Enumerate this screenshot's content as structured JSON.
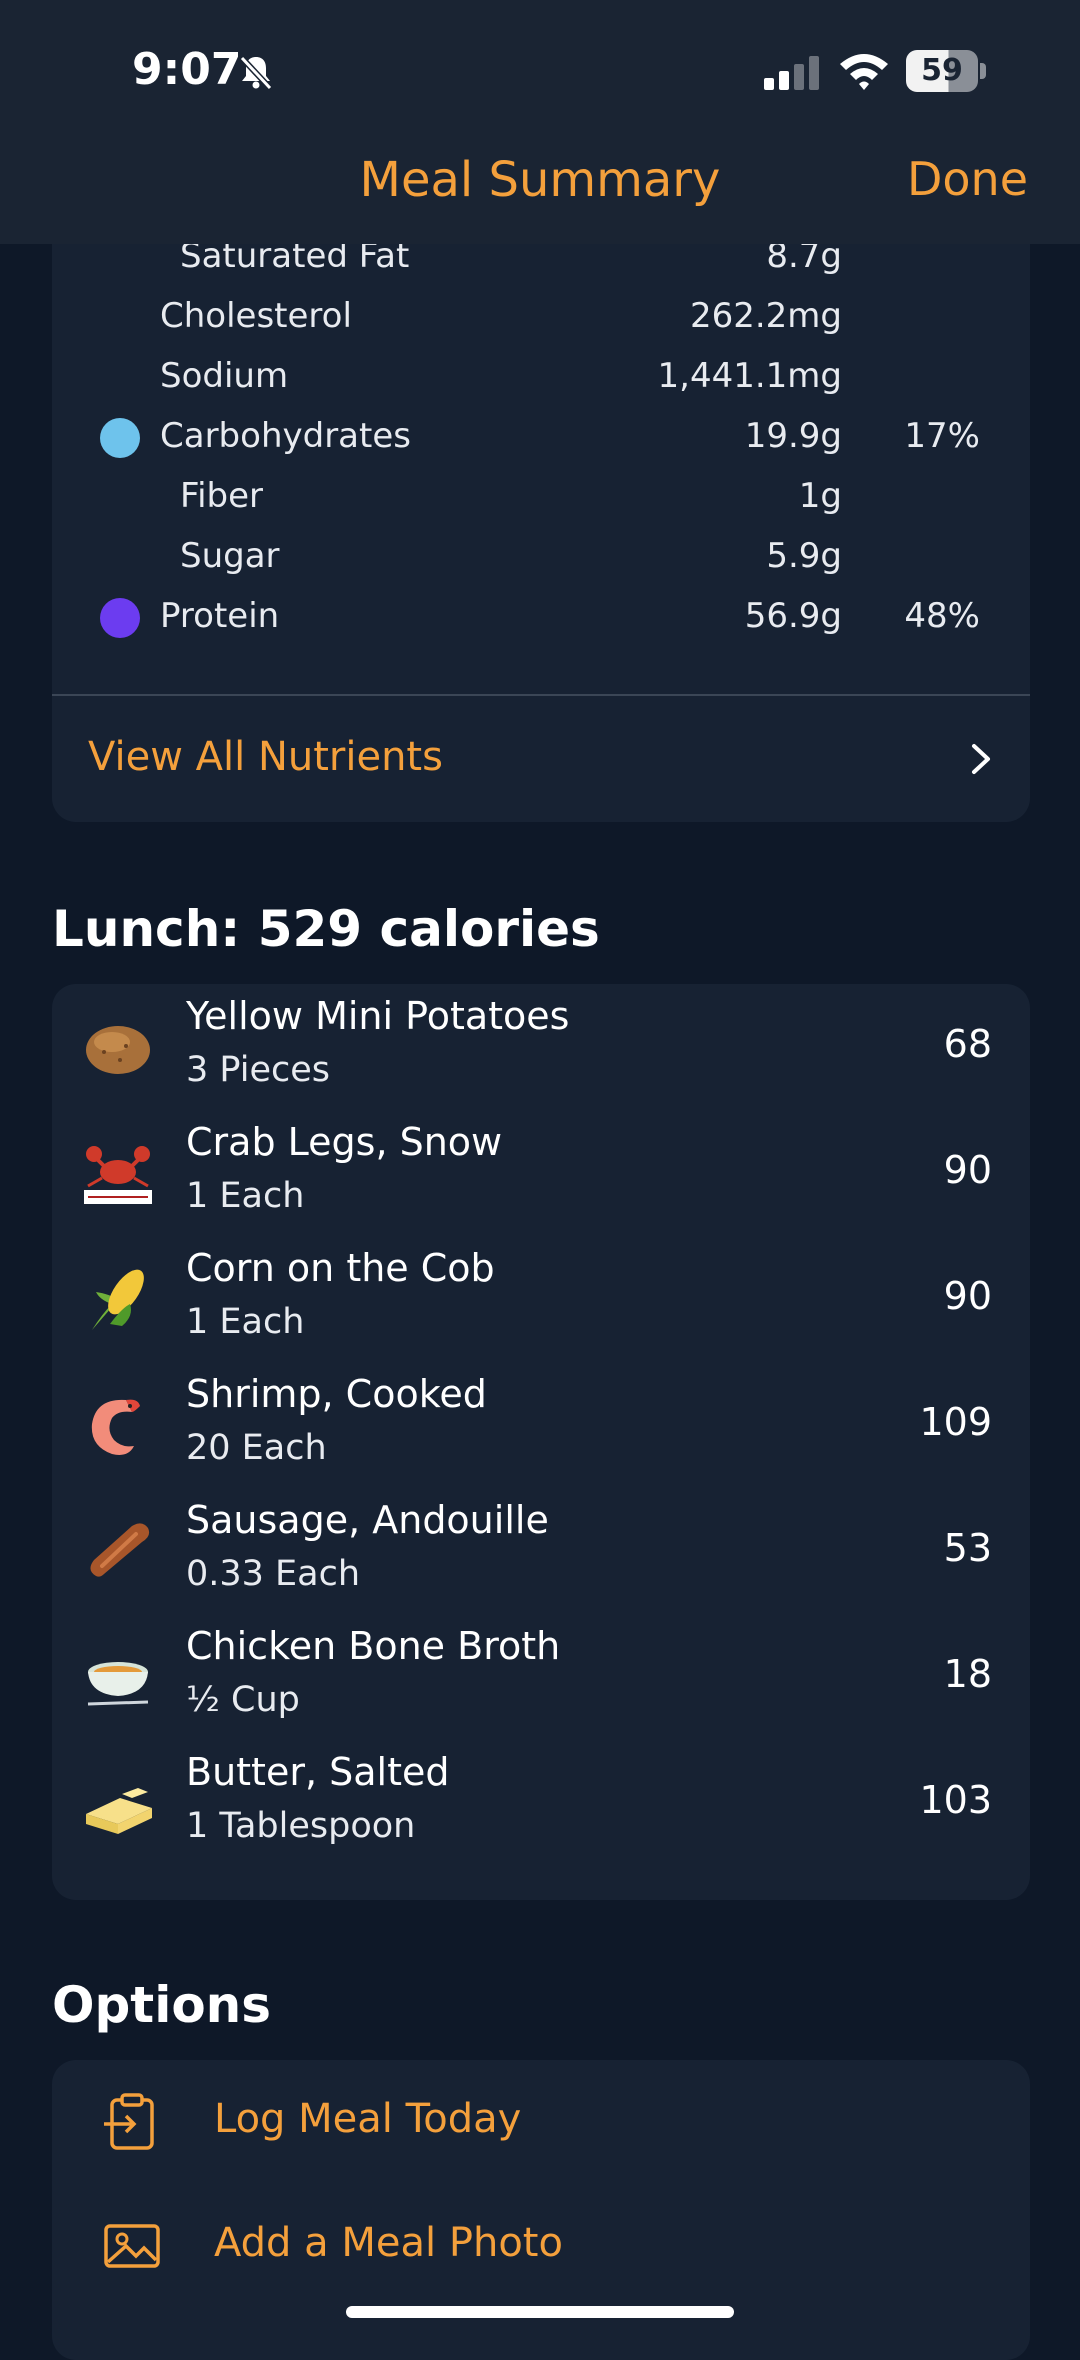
{
  "status_bar": {
    "time": "9:07",
    "battery": "59",
    "icons": [
      "bell-slash-icon",
      "signal-icon",
      "wifi-icon"
    ]
  },
  "nav": {
    "title": "Meal Summary",
    "done": "Done"
  },
  "nutrients": [
    {
      "label": "Saturated Fat",
      "value": "8.7g",
      "percent": "",
      "indent": 2,
      "color": ""
    },
    {
      "label": "Cholesterol",
      "value": "262.2mg",
      "percent": "",
      "indent": 1,
      "color": ""
    },
    {
      "label": "Sodium",
      "value": "1,441.1mg",
      "percent": "",
      "indent": 1,
      "color": ""
    },
    {
      "label": "Carbohydrates",
      "value": "19.9g",
      "percent": "17%",
      "indent": 1,
      "color": "#6ec3ec"
    },
    {
      "label": "Fiber",
      "value": "1g",
      "percent": "",
      "indent": 2,
      "color": ""
    },
    {
      "label": "Sugar",
      "value": "5.9g",
      "percent": "",
      "indent": 2,
      "color": ""
    },
    {
      "label": "Protein",
      "value": "56.9g",
      "percent": "48%",
      "indent": 1,
      "color": "#6c3cf0"
    }
  ],
  "view_all": {
    "label": "View All Nutrients"
  },
  "lunch": {
    "title": "Lunch: 529 calories",
    "items": [
      {
        "name": "Yellow Mini Potatoes",
        "qty": "3 Pieces",
        "calories": "68",
        "icon": "potato-icon"
      },
      {
        "name": "Crab Legs, Snow",
        "qty": "1 Each",
        "calories": "90",
        "icon": "crab-icon"
      },
      {
        "name": "Corn on the Cob",
        "qty": "1 Each",
        "calories": "90",
        "icon": "corn-icon"
      },
      {
        "name": "Shrimp, Cooked",
        "qty": "20 Each",
        "calories": "109",
        "icon": "shrimp-icon"
      },
      {
        "name": "Sausage, Andouille",
        "qty": "0.33 Each",
        "calories": "53",
        "icon": "sausage-icon"
      },
      {
        "name": "Chicken Bone Broth",
        "qty": "½ Cup",
        "calories": "18",
        "icon": "soup-bowl-icon"
      },
      {
        "name": "Butter, Salted",
        "qty": "1 Tablespoon",
        "calories": "103",
        "icon": "butter-icon"
      }
    ]
  },
  "options": {
    "title": "Options",
    "items": [
      {
        "label": "Log Meal Today",
        "icon": "clipboard-log-icon"
      },
      {
        "label": "Add a Meal Photo",
        "icon": "photo-icon"
      }
    ]
  },
  "colors": {
    "accent": "#f4a03c",
    "background": "#0e1828",
    "card": "#172233",
    "carbs": "#6ec3ec",
    "protein": "#6c3cf0"
  }
}
